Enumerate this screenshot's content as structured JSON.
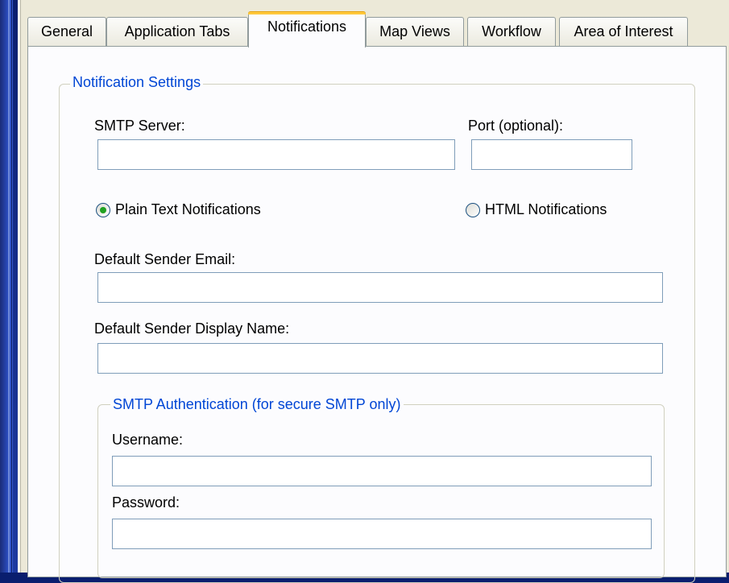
{
  "tabs": {
    "general": "General",
    "application_tabs": "Application Tabs",
    "notifications": "Notifications",
    "map_views": "Map Views",
    "workflow": "Workflow",
    "area_of_interest": "Area of Interest",
    "active": "Notifications"
  },
  "notification_settings": {
    "title": "Notification Settings",
    "smtp_server_label": "SMTP Server:",
    "smtp_server_value": "",
    "port_label": "Port (optional):",
    "port_value": "",
    "plain_text_label": "Plain Text Notifications",
    "plain_text_selected": true,
    "html_label": "HTML Notifications",
    "html_selected": false,
    "sender_email_label": "Default Sender Email:",
    "sender_email_value": "",
    "sender_display_label": "Default Sender Display Name:",
    "sender_display_value": ""
  },
  "smtp_auth": {
    "title": "SMTP Authentication (for secure SMTP only)",
    "username_label": "Username:",
    "username_value": "",
    "password_label": "Password:",
    "password_value": ""
  },
  "colors": {
    "group_title": "#0046d5",
    "active_tab_highlight": "#ffc83c",
    "radio_selected": "#21a121",
    "input_border": "#7f9db9"
  }
}
